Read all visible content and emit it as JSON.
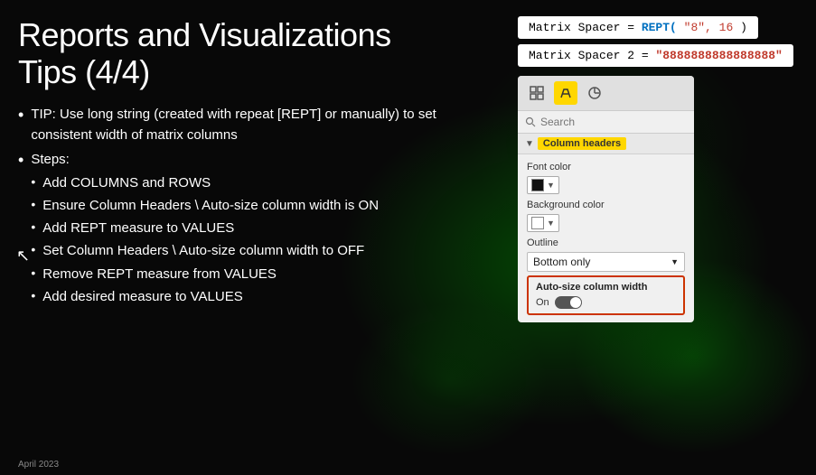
{
  "title": {
    "line1": "Reports and Visualizations",
    "line2": "Tips (4/4)"
  },
  "bullets": [
    {
      "text": "TIP: Use long string (created with repeat [REPT] or manually) to set consistent width of matrix columns"
    },
    {
      "text": "Steps:",
      "sub": [
        "Add COLUMNS and ROWS",
        "Ensure Column Headers \\ Auto-size column width is ON",
        "Add REPT measure to VALUES",
        "Set Column Headers \\ Auto-size column width to OFF",
        "Remove REPT measure from VALUES",
        "Add desired measure to VALUES"
      ]
    }
  ],
  "formula1": {
    "prefix": "Matrix Spacer = ",
    "fn": "REPT(",
    "arg1": " \"8\", 16 ",
    "suffix": ")"
  },
  "formula2": {
    "prefix": "Matrix Spacer 2 = ",
    "value": "\"8888888888888888\""
  },
  "panel": {
    "tabs": [
      {
        "icon": "⊞",
        "label": "fields-tab",
        "active": false
      },
      {
        "icon": "🖌",
        "label": "format-tab",
        "active": true
      },
      {
        "icon": "🔍",
        "label": "analytics-tab",
        "active": false
      }
    ],
    "search_placeholder": "Search",
    "section_label": "Column headers",
    "font_color_label": "Font color",
    "background_color_label": "Background color",
    "outline_label": "Outline",
    "outline_value": "Bottom only",
    "autosize_label": "Auto-size column width",
    "toggle_label": "On"
  },
  "footer": "April 2023"
}
